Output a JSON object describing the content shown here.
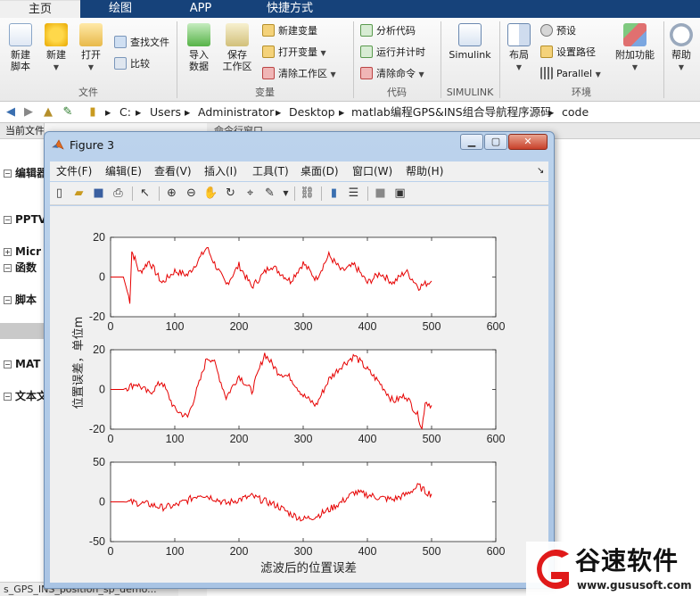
{
  "ribbon_tabs": [
    "主页",
    "绘图",
    "APP",
    "快捷方式"
  ],
  "ribbon": {
    "file_group": {
      "label": "文件",
      "new_script": "新建\n脚本",
      "new": "新建",
      "open": "打开",
      "find_files": "查找文件",
      "compare": "比较"
    },
    "variable_group": {
      "label": "变量",
      "import": "导入\n数据",
      "save_ws": "保存\n工作区",
      "new_var": "新建变量",
      "open_var": "打开变量",
      "clear_ws": "清除工作区"
    },
    "code_group": {
      "label": "代码",
      "analyze": "分析代码",
      "run_time": "运行并计时",
      "clear_cmd": "清除命令"
    },
    "simulink_group": {
      "label": "SIMULINK",
      "simulink": "Simulink"
    },
    "env_group": {
      "label": "环境",
      "layout": "布局",
      "prefs": "预设",
      "set_path": "设置路径",
      "parallel": "Parallel",
      "addons": "附加功能"
    },
    "help": "帮助"
  },
  "address": {
    "crumbs": [
      "C:",
      "Users",
      "Administrator",
      "Desktop",
      "matlab编程GPS&INS组合导航程序源码",
      "code"
    ]
  },
  "left_panel": {
    "header": "当前文件夹",
    "rows": [
      "编辑器",
      "PPTV",
      "Micr",
      "函数",
      "脚本",
      "MAT",
      "文本文"
    ]
  },
  "cmd_panel": {
    "header": "命令行窗口"
  },
  "status_bar": {
    "filename": "s_GPS_INS_position_sp_demo..."
  },
  "figure": {
    "title": "Figure 3",
    "menu": [
      "文件(F)",
      "编辑(E)",
      "查看(V)",
      "插入(I)",
      "工具(T)",
      "桌面(D)",
      "窗口(W)",
      "帮助(H)"
    ]
  },
  "chart_data": [
    {
      "type": "line",
      "x_range": [
        0,
        600
      ],
      "xticks": [
        0,
        100,
        200,
        300,
        400,
        500,
        600
      ],
      "ylim": [
        -20,
        20
      ],
      "yticks": [
        -20,
        0,
        20
      ],
      "color": "#e60000",
      "series": [
        {
          "x": [
            0,
            20,
            30,
            33,
            38,
            45,
            60,
            80,
            100,
            120,
            140,
            150,
            160,
            180,
            200,
            220,
            250,
            280,
            300,
            320,
            340,
            360,
            380,
            400,
            420,
            440,
            460,
            480,
            500
          ],
          "values": [
            0,
            0,
            -12,
            13,
            9,
            2,
            8,
            -3,
            3,
            1,
            10,
            15,
            8,
            -4,
            6,
            -5,
            6,
            -2,
            7,
            -1,
            11,
            3,
            6,
            -3,
            2,
            -3,
            3,
            -5,
            -2
          ]
        }
      ]
    },
    {
      "type": "line",
      "x_range": [
        0,
        600
      ],
      "xticks": [
        0,
        100,
        200,
        300,
        400,
        500,
        600
      ],
      "ylim": [
        -20,
        20
      ],
      "yticks": [
        -20,
        0,
        20
      ],
      "ylabel": "位置误差，单位m",
      "color": "#e60000",
      "series": [
        {
          "x": [
            0,
            20,
            40,
            60,
            80,
            100,
            120,
            140,
            150,
            160,
            180,
            200,
            220,
            240,
            260,
            280,
            300,
            320,
            340,
            360,
            380,
            400,
            420,
            440,
            460,
            480,
            485,
            490,
            500
          ],
          "values": [
            0,
            0,
            3,
            -2,
            4,
            -10,
            -14,
            5,
            16,
            15,
            -4,
            7,
            -1,
            18,
            9,
            6,
            -3,
            -8,
            5,
            12,
            17,
            10,
            3,
            -6,
            -3,
            -14,
            -20,
            -6,
            -8
          ]
        }
      ]
    },
    {
      "type": "line",
      "x_range": [
        0,
        600
      ],
      "xticks": [
        0,
        100,
        200,
        300,
        400,
        500,
        600
      ],
      "ylim": [
        -50,
        50
      ],
      "yticks": [
        -50,
        0,
        50
      ],
      "xlabel": "滤波后的位置误差",
      "color": "#e60000",
      "series": [
        {
          "x": [
            0,
            20,
            40,
            60,
            80,
            100,
            120,
            140,
            160,
            180,
            200,
            220,
            240,
            260,
            280,
            300,
            320,
            340,
            360,
            380,
            400,
            420,
            440,
            460,
            470,
            480,
            490,
            500
          ],
          "values": [
            0,
            0,
            -1,
            -3,
            -7,
            -5,
            2,
            10,
            5,
            -2,
            3,
            7,
            1,
            -5,
            -15,
            -22,
            -18,
            -10,
            0,
            12,
            9,
            5,
            3,
            9,
            15,
            20,
            13,
            10
          ]
        }
      ]
    }
  ],
  "watermark": {
    "name": "谷速软件",
    "url": "www.gususoft.com"
  }
}
